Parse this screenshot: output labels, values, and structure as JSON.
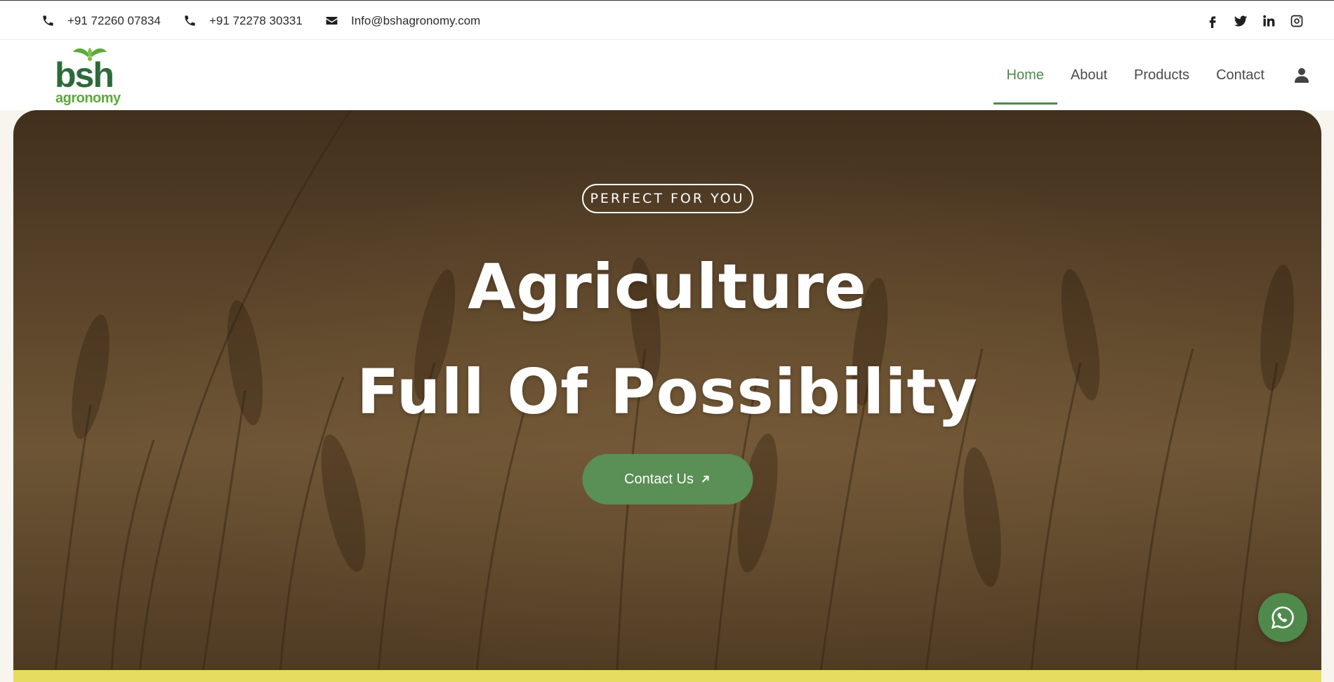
{
  "topbar": {
    "phone_1": "+91 72260 07834",
    "phone_2": "+91 72278 30331",
    "email": "Info@bshagronomy.com",
    "icons": {
      "phone": "phone-icon",
      "email": "envelope-icon"
    },
    "socials": [
      "facebook-icon",
      "twitter-icon",
      "linkedin-icon",
      "instagram-icon"
    ]
  },
  "header": {
    "logo": {
      "top_text": "bsh",
      "bottom_text": "agronomy"
    },
    "nav": [
      {
        "label": "Home",
        "active": true
      },
      {
        "label": "About",
        "active": false
      },
      {
        "label": "Products",
        "active": false
      },
      {
        "label": "Contact",
        "active": false
      }
    ],
    "user_icon": "user-icon"
  },
  "hero": {
    "tagline": "PERFECT FOR YOU",
    "title_line_1": "Agriculture",
    "title_line_2": "Full Of Possibility",
    "cta_label": "Contact Us"
  },
  "floating": {
    "whatsapp_icon": "whatsapp-icon"
  },
  "colors": {
    "accent": "#4e8a4e",
    "cta": "#5a8f55",
    "whatsapp": "#4f8a4c",
    "band": "#e6dc5f"
  }
}
